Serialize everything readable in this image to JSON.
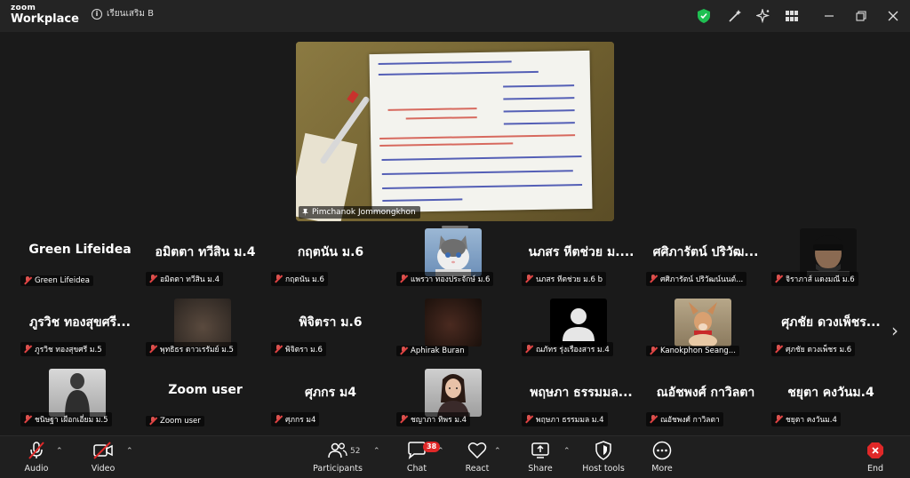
{
  "app": {
    "brand_line1": "zoom",
    "brand_line2": "Workplace",
    "meeting_title": "เรียนเสริม B"
  },
  "share": {
    "presenter": "Pimchanok Jommongkhon"
  },
  "gallery": [
    {
      "display": "Green Lifeidea",
      "label": "Green Lifeidea",
      "has_video": false
    },
    {
      "display": "อมิตตา ทวีสิน ม.4",
      "label": "อมิตตา ทวีสิน ม.4",
      "has_video": false
    },
    {
      "display": "กฤตนัน ม.6",
      "label": "กฤตนัน ม.6",
      "has_video": false
    },
    {
      "display": "",
      "label": "แพรวา ทองประจักษ์ ม.6",
      "has_video": true
    },
    {
      "display": "นภสร หีตช่วย ม....",
      "label": "นภสร หีตช่วย ม.6 b",
      "has_video": false
    },
    {
      "display": "ศศิภารัตน์ ปริวัฒ...",
      "label": "ศศิภารัตน์ ปริวัฒน์นนต์...",
      "has_video": false
    },
    {
      "display": "",
      "label": "จิราภาส์ แดงมณี ม.6",
      "has_video": true
    },
    {
      "display": "ภูรวิช ทองสุขศรี...",
      "label": "ภูรวิช ทองสุขศรี ม.5",
      "has_video": false
    },
    {
      "display": "",
      "label": "พุทธิธร ดาวเรรัมย์ ม.5",
      "has_video": true
    },
    {
      "display": "พิจิตรา ม.6",
      "label": "พิจิตรา ม.6",
      "has_video": false
    },
    {
      "display": "",
      "label": "Aphirak Buran",
      "has_video": true
    },
    {
      "display": "",
      "label": "ณภัทร รุ่งเรืองสาร ม.4",
      "has_video": true
    },
    {
      "display": "",
      "label": "Kanokphon Seang...",
      "has_video": true
    },
    {
      "display": "ศุภชัย ดวงเพ็ชร...",
      "label": "ศุภชัย ดวงเพ็ชร ม.6",
      "has_video": false
    },
    {
      "display": "",
      "label": "ชนิษฐา เผือกเอี่ยม ม.5",
      "has_video": true
    },
    {
      "display": "Zoom user",
      "label": "Zoom user",
      "has_video": false
    },
    {
      "display": "ศุภกร ม4",
      "label": "ศุภกร ม4",
      "has_video": false
    },
    {
      "display": "",
      "label": "ชญาภา ทิพร ม.4",
      "has_video": true
    },
    {
      "display": "พฤษภา ธรรมมล...",
      "label": "พฤษภา ธรรมมล ม.4",
      "has_video": false
    },
    {
      "display": "ณอัชพงศ์ กาวิลตา",
      "label": "ณอัชพงศ์ กาวิลตา",
      "has_video": false
    },
    {
      "display": "ชยุตา คงวันม.4",
      "label": "ชยุตา คงวันม.4",
      "has_video": false
    }
  ],
  "toolbar": {
    "audio": "Audio",
    "video": "Video",
    "participants": "Participants",
    "participants_count": "52",
    "chat": "Chat",
    "chat_badge": "38",
    "react": "React",
    "share": "Share",
    "host_tools": "Host tools",
    "more": "More",
    "end": "End"
  },
  "colors": {
    "shield": "#1fbf52",
    "end": "#e02828",
    "muted": "#e04343"
  }
}
